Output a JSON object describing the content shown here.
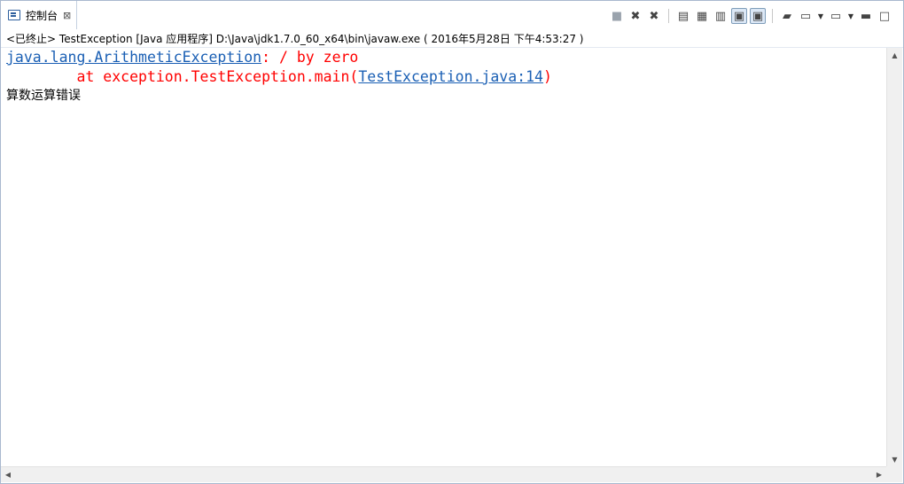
{
  "tab": {
    "label": "控制台",
    "close_glyph": "⊠",
    "icon": "console-icon"
  },
  "toolbar": {
    "icons": [
      "terminate-icon",
      "remove-launch-icon",
      "remove-all-terminated-icon",
      "clear-console-icon",
      "scroll-lock-icon",
      "word-wrap-icon",
      "show-console-on-stdout-icon",
      "show-console-on-stderr-icon",
      "pin-console-icon",
      "display-selected-console-icon",
      "open-console-icon",
      "minimize-icon",
      "maximize-icon"
    ],
    "glyphs": {
      "terminate": "■",
      "remove_launch": "✖",
      "remove_all": "✖",
      "clear": "▤",
      "scroll_lock": "▦",
      "word_wrap": "▥",
      "stdout": "▣",
      "stderr": "▣",
      "pin": "▰",
      "display": "▭",
      "open": "▭",
      "dropdown": "▼",
      "minimize": "▬",
      "maximize": "□"
    }
  },
  "status": {
    "text": "<已终止> TestException [Java 应用程序] D:\\Java\\jdk1.7.0_60_x64\\bin\\javaw.exe ( 2016年5月28日 下午4:53:27 )"
  },
  "console": {
    "line1": {
      "exception_class": "java.lang.ArithmeticException",
      "message": ": / by zero"
    },
    "line2": {
      "prefix": "        at exception.TestException.main(",
      "link": "TestException.java:14",
      "suffix": ")"
    },
    "line3": {
      "text": "算数运算错误"
    }
  },
  "scrollbars": {
    "up": "▲",
    "down": "▼",
    "left": "◀",
    "right": "▶"
  },
  "colors": {
    "stderr": "#ff0000",
    "link": "#1a5fb4",
    "stdout": "#000000",
    "border": "#a9b8cf"
  }
}
